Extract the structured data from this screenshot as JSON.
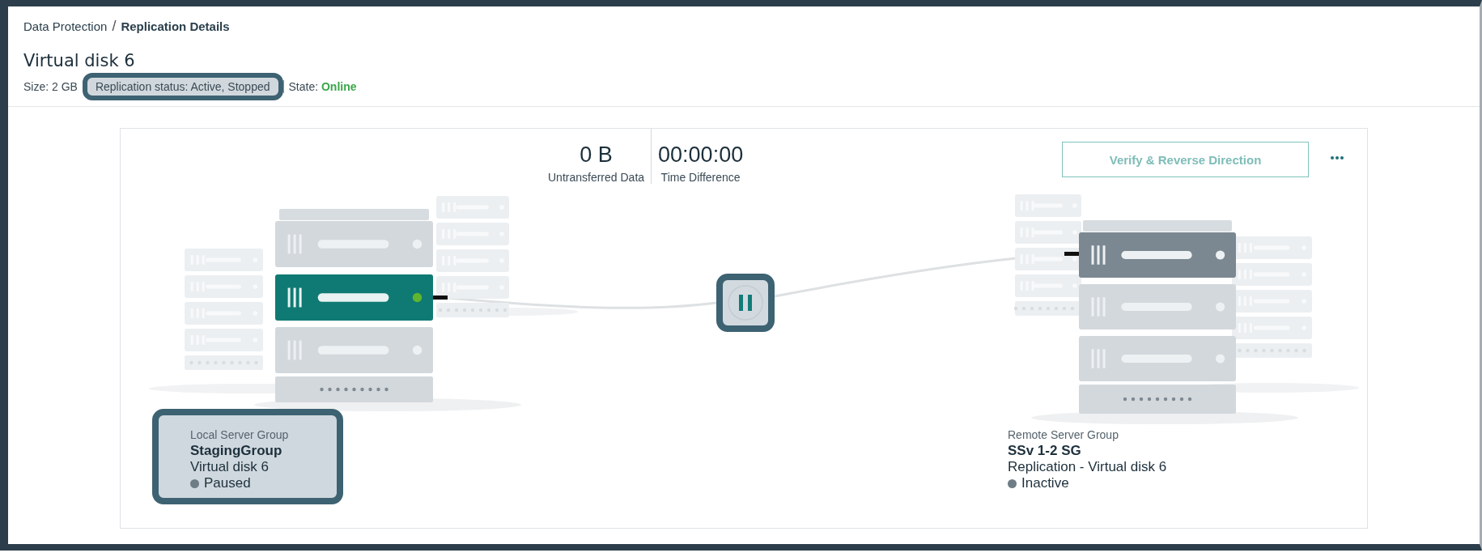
{
  "breadcrumb": [
    {
      "label": "Data Protection",
      "current": false
    },
    {
      "label": "Replication Details",
      "current": true
    }
  ],
  "breadcrumb_separator": "/",
  "title": "Virtual disk 6",
  "meta": [
    {
      "kind": "plain",
      "text": "Size: 2 GB",
      "highlighted": false
    },
    {
      "kind": "plain",
      "text": "Replication status: Active, Stopped",
      "highlighted": true
    },
    {
      "kind": "state",
      "label": "State:",
      "value": "Online",
      "highlighted": false
    }
  ],
  "metrics": [
    {
      "value": "0 B",
      "label": "Untransferred Data"
    },
    {
      "value": "00:00:00",
      "label": "Time Difference"
    }
  ],
  "action_button": "Verify & Reverse Direction",
  "pause_button": {
    "highlighted": true
  },
  "server_groups": [
    {
      "kind": "local",
      "caption": "Local Server Group",
      "name": "StagingGroup",
      "disk": "Virtual disk 6",
      "status": "Paused",
      "color": "#6e7c86",
      "highlighted": true
    },
    {
      "kind": "remote",
      "caption": "Remote Server Group",
      "name": "SSv 1-2 SG",
      "disk": "Replication - Virtual disk 6",
      "status": "Inactive",
      "color": "#6e7c86",
      "highlighted": false
    }
  ]
}
